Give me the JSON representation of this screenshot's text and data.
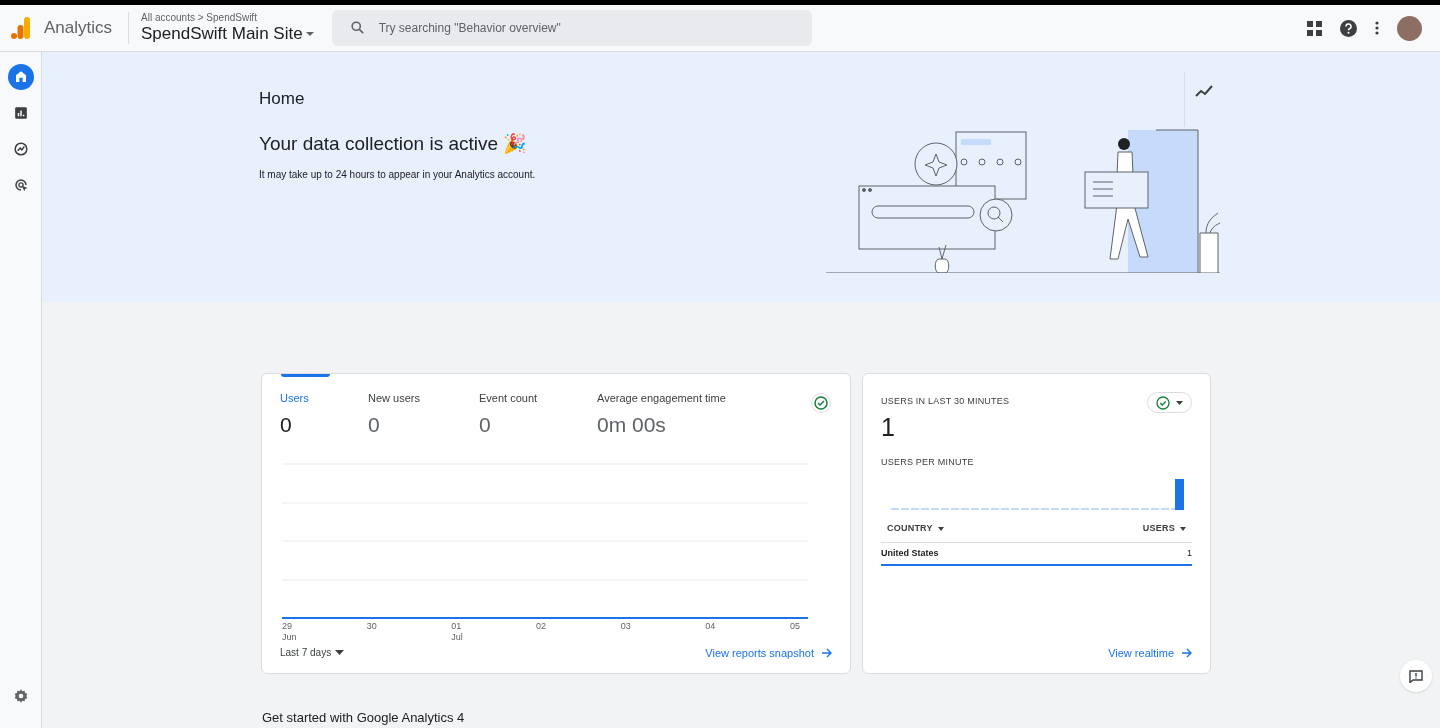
{
  "header": {
    "product": "Analytics",
    "breadcrumb": "All accounts > SpendSwift",
    "property": "SpendSwift Main Site",
    "search": {
      "placeholder": "Try searching \"Behavior overview\""
    }
  },
  "sidebar": {
    "items": [
      {
        "kind": "home",
        "selected": true
      },
      {
        "kind": "reports",
        "selected": false
      },
      {
        "kind": "explore",
        "selected": false
      },
      {
        "kind": "advertising",
        "selected": false
      }
    ]
  },
  "banner": {
    "title": "Home",
    "heading": "Your data collection is active 🎉",
    "note": "It may take up to 24 hours to appear in your Analytics account."
  },
  "overview_card": {
    "metrics": [
      {
        "label": "Users",
        "value": "0",
        "selected": true
      },
      {
        "label": "New users",
        "value": "0",
        "selected": false
      },
      {
        "label": "Event count",
        "value": "0",
        "selected": false
      },
      {
        "label": "Average engagement time",
        "value": "0m 00s",
        "selected": false
      }
    ],
    "x_labels": [
      {
        "day": "29",
        "month": "Jun"
      },
      {
        "day": "30"
      },
      {
        "day": "01",
        "month": "Jul"
      },
      {
        "day": "02"
      },
      {
        "day": "03"
      },
      {
        "day": "04"
      },
      {
        "day": "05"
      }
    ],
    "date_range": "Last 7 days",
    "link": "View reports snapshot"
  },
  "realtime_card": {
    "title": "USERS IN LAST 30 MINUTES",
    "value": "1",
    "subtitle": "USERS PER MINUTE",
    "columns": [
      "COUNTRY",
      "USERS"
    ],
    "rows": [
      [
        "United States",
        "1"
      ]
    ],
    "link": "View realtime"
  },
  "footer_heading": "Get started with Google Analytics 4"
}
